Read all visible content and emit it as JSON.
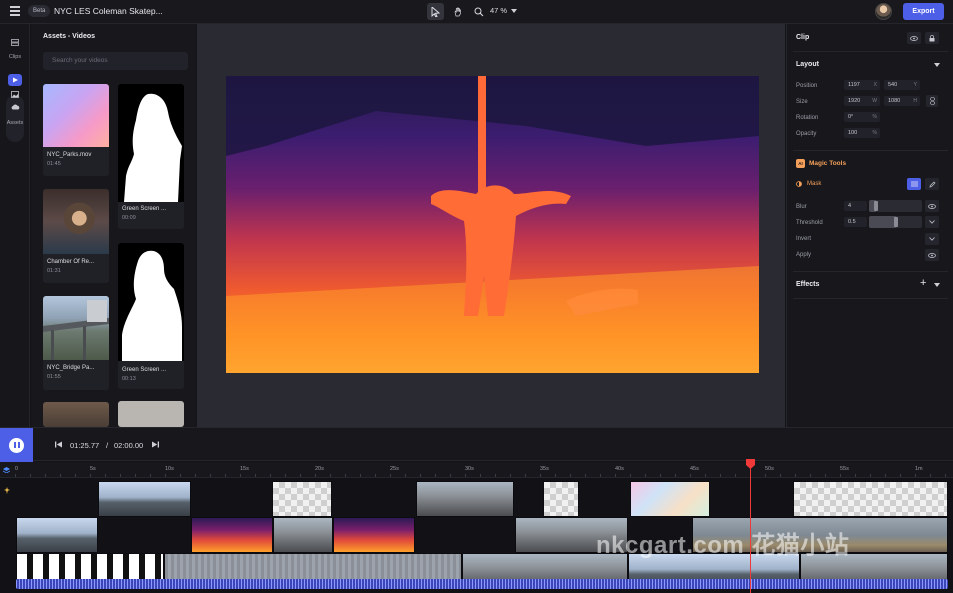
{
  "topbar": {
    "beta_badge": "Beta",
    "project_title": "NYC LES Coleman Skatep...",
    "zoom": "47 %",
    "export_label": "Export"
  },
  "rail": {
    "clips_label": "Clips",
    "assets_label": "Assets"
  },
  "assets": {
    "title": "Assets - Videos",
    "search_placeholder": "Search your videos",
    "items": [
      {
        "name": "NYC_Parks.mov",
        "duration": "01:45"
      },
      {
        "name": "Green Screen ...",
        "duration": "00:09"
      },
      {
        "name": "Chamber Of Re...",
        "duration": "01:31"
      },
      {
        "name": "Green Screen ...",
        "duration": "00:13"
      },
      {
        "name": "NYC_Bridge Pa...",
        "duration": "01:55"
      }
    ]
  },
  "right_panel": {
    "title": "Clip",
    "layout_title": "Layout",
    "position_label": "Position",
    "position_x": "1197",
    "position_x_unit": "X",
    "position_y": "540",
    "position_y_unit": "Y",
    "size_label": "Size",
    "size_w": "1920",
    "size_w_unit": "W",
    "size_h": "1080",
    "size_h_unit": "H",
    "rotation_label": "Rotation",
    "rotation_val": "0°",
    "rotation_unit": "%",
    "opacity_label": "Opacity",
    "opacity_val": "100",
    "opacity_unit": "%",
    "magic_badge": "AI",
    "magic_title": "Magic Tools",
    "mask_label": "Mask",
    "blur_label": "Blur",
    "blur_val": "4",
    "blur_level": 0.13,
    "threshold_label": "Threshold",
    "threshold_val": "0.5",
    "threshold_level": 0.5,
    "invert_label": "Invert",
    "apply_label": "Apply",
    "effects_title": "Effects"
  },
  "transport": {
    "current_time": "01:25.77",
    "separator": "/",
    "total_time": "02:00.00"
  },
  "timeline": {
    "ruler": [
      "0",
      "5s",
      "10s",
      "15s",
      "20s",
      "25s",
      "30s",
      "35s",
      "40s",
      "45s",
      "50s",
      "55s",
      "1m"
    ],
    "playhead_seconds": 49.5
  },
  "watermark": "nkcgart.com 花猫小站",
  "colors": {
    "accent": "#4d5fe6",
    "playhead": "#f03a3a",
    "magic": "#f5a05a"
  }
}
